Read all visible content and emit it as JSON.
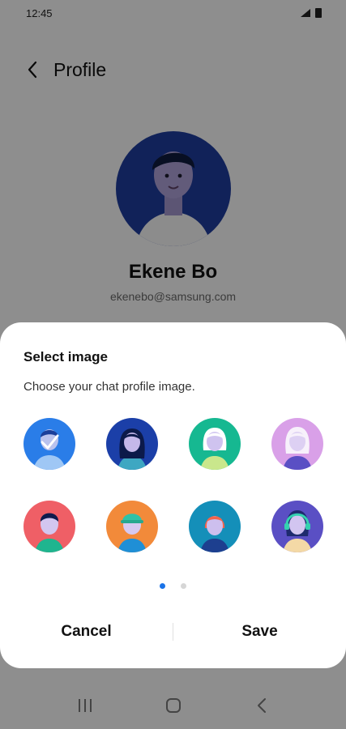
{
  "status_bar": {
    "time": "12:45"
  },
  "header": {
    "title": "Profile"
  },
  "profile": {
    "name": "Ekene Bo",
    "email": "ekenebo@samsung.com"
  },
  "dialog": {
    "title": "Select image",
    "subtitle": "Choose your chat profile image.",
    "avatars": [
      {
        "icon": "avatar-blue-boy-selected",
        "bg": "#2a7de8",
        "selected": true
      },
      {
        "icon": "avatar-longhair-girl",
        "bg": "#1b3fa8",
        "selected": false
      },
      {
        "icon": "avatar-bob-girl",
        "bg": "#16b891",
        "selected": false
      },
      {
        "icon": "avatar-whitehair-girl",
        "bg": "#d9a0e8",
        "selected": false
      },
      {
        "icon": "avatar-red-boy",
        "bg": "#ef5f66",
        "selected": false
      },
      {
        "icon": "avatar-cap-boy",
        "bg": "#f28a3a",
        "selected": false
      },
      {
        "icon": "avatar-orange-girl",
        "bg": "#148fb9",
        "selected": false
      },
      {
        "icon": "avatar-headset-girl",
        "bg": "#5a4fc4",
        "selected": false
      }
    ],
    "page_count": 2,
    "current_page": 1,
    "cancel_label": "Cancel",
    "save_label": "Save"
  },
  "colors": {
    "accent": "#1a73e8",
    "scrim": "rgba(0,0,0,0.42)"
  }
}
